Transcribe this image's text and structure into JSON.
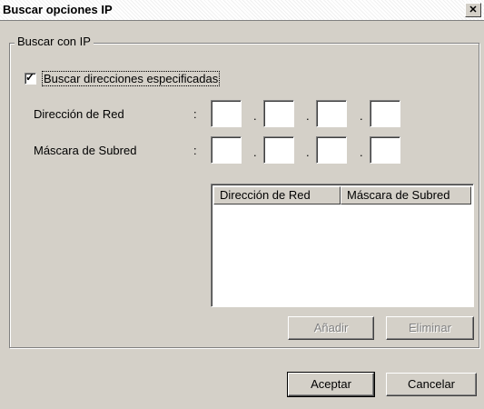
{
  "window": {
    "title": "Buscar opciones IP",
    "close_glyph": "✕"
  },
  "group": {
    "legend": "Buscar con IP"
  },
  "checkbox": {
    "label": "Buscar direcciones especificadas",
    "checked": true,
    "glyph": "✓"
  },
  "fields": {
    "network_label": "Dirección de Red",
    "mask_label": "Máscara de Subred",
    "colon": ":",
    "separator": "."
  },
  "list": {
    "columns": [
      "Dirección de Red",
      "Máscara de Subred"
    ]
  },
  "buttons": {
    "add_label": "Añadir",
    "remove_label": "Eliminar",
    "ok_label": "Aceptar",
    "cancel_label": "Cancelar"
  }
}
